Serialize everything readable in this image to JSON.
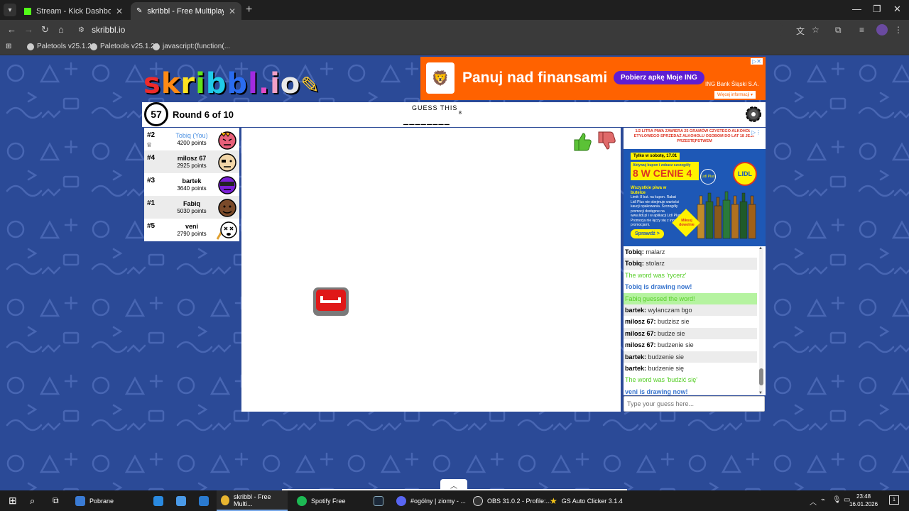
{
  "browser": {
    "tabs": [
      {
        "title": "Stream - Kick Dashboard",
        "active": false
      },
      {
        "title": "skribbl - Free Multiplayer Drawing",
        "active": true
      }
    ],
    "url": "skribbl.io",
    "bookmarks": [
      "Paletools v25.1.24",
      "Paletools v25.1.24",
      "javascript:(function(..."
    ]
  },
  "game": {
    "logo": "skribbl.io",
    "timer": "57",
    "round": "Round 6 of 10",
    "guess_label": "GUESS THIS",
    "hint": "________",
    "hint_length": "8"
  },
  "players": [
    {
      "rank": "#2",
      "name": "Tobiq (You)",
      "points": "4200 points",
      "me": true,
      "crown": true
    },
    {
      "rank": "#4",
      "name": "milosz 67",
      "points": "2925 points"
    },
    {
      "rank": "#3",
      "name": "bartek",
      "points": "3640 points"
    },
    {
      "rank": "#1",
      "name": "Fabiq",
      "points": "5030 points"
    },
    {
      "rank": "#5",
      "name": "veni",
      "points": "2790 points",
      "drawing": true
    }
  ],
  "ads": {
    "ing": {
      "headline": "Panuj nad finansami",
      "button": "Pobierz apkę Moje ING",
      "bank": "ING Bank Śląski S.A.",
      "more": "Więcej informacji ▾",
      "brand_color": "#ff6200"
    },
    "lidl": {
      "warning": "1/2 LITRA PIWA ZAWIERA 25 GRAMÓW CZYSTEGO ALKOHOLU ETYLOWEGO SPRZEDAŻ ALKOHOLU OSOBOM DO LAT 18 JEST PRZESTĘPSTWEM",
      "dates": "Tylko w sobotę, 17.01",
      "promo_small": "Aktywuj kupon i zobacz szczegóły",
      "promo_big": "8 W CENIE 4",
      "plus": "Lidl Plus",
      "logo": "LIDL",
      "title": "Wszystkie piwa w butelce",
      "body": "Limit: 8 but. na kupon. Rabat Lidl Plus nie obejmuje wartości kaucji opakowania. Szczegóły promocji dostępne na www.lidl.pl i w aplikacji Lidl Plus. Promocja nie łączy się z innymi promocjami.",
      "mix": "Miksuj dowolnie",
      "button": "Sprawdź >"
    }
  },
  "chat": [
    {
      "user": "Tobiq",
      "text": "malarz",
      "style": "normal"
    },
    {
      "user": "Tobiq",
      "text": "stolarz",
      "style": "normal"
    },
    {
      "text": "The word was 'rycerz'",
      "style": "green"
    },
    {
      "text": "Tobiq is drawing now!",
      "style": "blue"
    },
    {
      "text": "Fabiq guessed the word!",
      "style": "greenbg"
    },
    {
      "user": "bartek",
      "text": "wylanczam bgo",
      "style": "normal"
    },
    {
      "user": "milosz 67",
      "text": "budzisz sie",
      "style": "normal"
    },
    {
      "user": "milosz 67",
      "text": "budze sie",
      "style": "normal"
    },
    {
      "user": "milosz 67",
      "text": "budzenie sie",
      "style": "normal"
    },
    {
      "user": "bartek",
      "text": "budzenie sie",
      "style": "normal"
    },
    {
      "user": "bartek",
      "text": "budzenie się",
      "style": "normal"
    },
    {
      "text": "The word was 'budzić się'",
      "style": "green"
    },
    {
      "text": "veni is drawing now!",
      "style": "blue"
    }
  ],
  "chat_input": {
    "placeholder": "Type your guess here..."
  },
  "taskbar": {
    "items": [
      "Pobrane",
      "skribbl - Free Multi...",
      "Spotify Free",
      "#ogólny | ziomy - ...",
      "OBS 31.0.2 - Profile:...",
      "GS Auto Clicker 3.1.4"
    ],
    "time": "23:48",
    "date": "16.01.2026"
  }
}
